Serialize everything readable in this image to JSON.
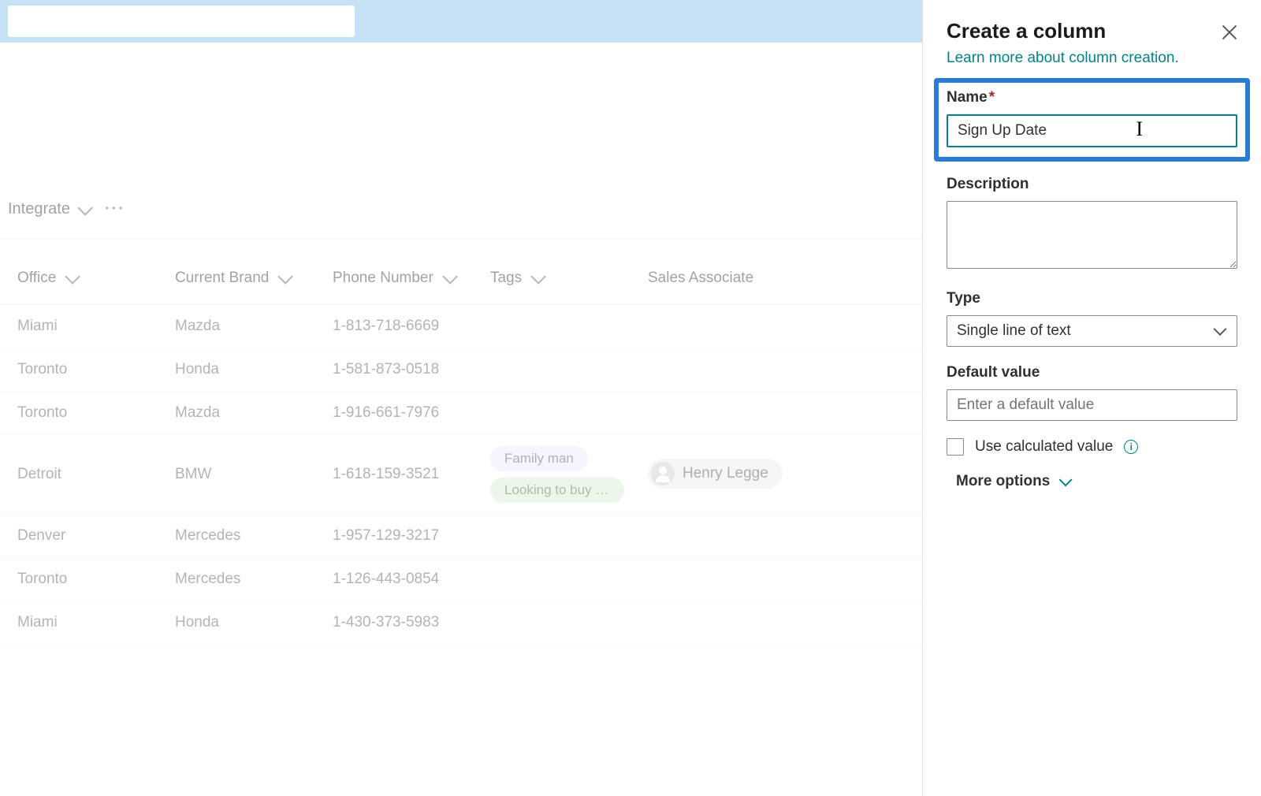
{
  "header": {
    "search_value": ""
  },
  "toolbar": {
    "integrate": "Integrate"
  },
  "columns": {
    "office": "Office",
    "brand": "Current Brand",
    "phone": "Phone Number",
    "tags": "Tags",
    "sales": "Sales Associate"
  },
  "rows": [
    {
      "office": "Miami",
      "brand": "Mazda",
      "phone": "1-813-718-6669",
      "tags": [],
      "sales": null
    },
    {
      "office": "Toronto",
      "brand": "Honda",
      "phone": "1-581-873-0518",
      "tags": [],
      "sales": null
    },
    {
      "office": "Toronto",
      "brand": "Mazda",
      "phone": "1-916-661-7976",
      "tags": [],
      "sales": null
    },
    {
      "office": "Detroit",
      "brand": "BMW",
      "phone": "1-618-159-3521",
      "tags": [
        "Family man",
        "Looking to buy s..."
      ],
      "sales": "Henry Legge"
    },
    {
      "office": "Denver",
      "brand": "Mercedes",
      "phone": "1-957-129-3217",
      "tags": [],
      "sales": null
    },
    {
      "office": "Toronto",
      "brand": "Mercedes",
      "phone": "1-126-443-0854",
      "tags": [],
      "sales": null
    },
    {
      "office": "Miami",
      "brand": "Honda",
      "phone": "1-430-373-5983",
      "tags": [],
      "sales": null
    }
  ],
  "panel": {
    "title": "Create a column",
    "learn_more": "Learn more about column creation.",
    "name_label": "Name",
    "name_value": "Sign Up Date",
    "desc_label": "Description",
    "desc_value": "",
    "type_label": "Type",
    "type_value": "Single line of text",
    "default_label": "Default value",
    "default_placeholder": "Enter a default value",
    "calc_label": "Use calculated value",
    "more_options": "More options"
  }
}
